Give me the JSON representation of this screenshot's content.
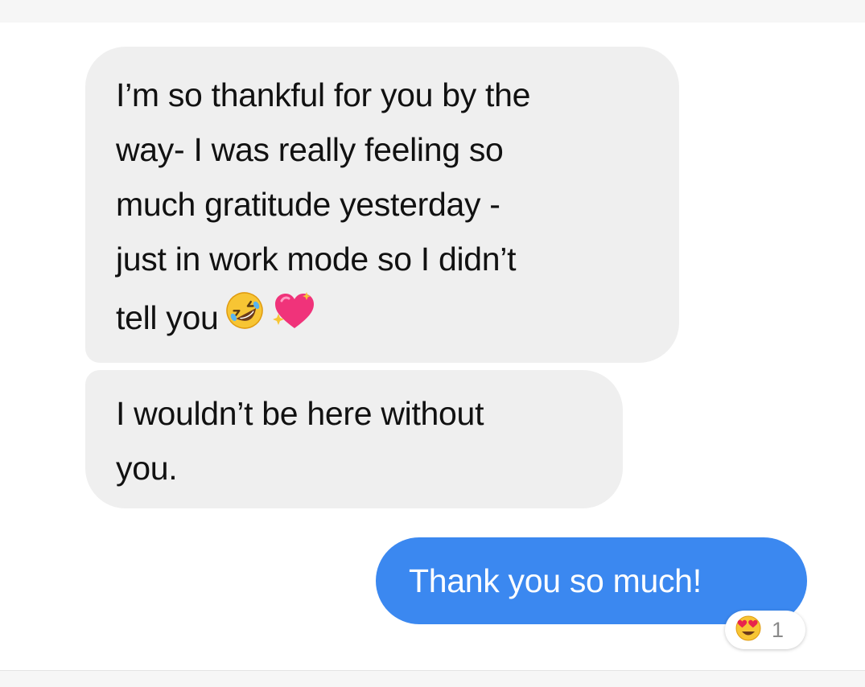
{
  "conversation": {
    "messages": [
      {
        "sender": "other",
        "lines": [
          "I’m so thankful for you by the",
          "way- I was really feeling so",
          "much gratitude yesterday -",
          "just in work mode so I didn’t",
          "tell you"
        ],
        "emojis": [
          "rolling-on-floor-laughing-emoji",
          "sparkling-heart-emoji"
        ]
      },
      {
        "sender": "other",
        "lines": [
          "I wouldn’t be here without",
          "you."
        ]
      },
      {
        "sender": "me",
        "text": "Thank you so much!",
        "reaction": {
          "emoji": "heart-eyes-emoji",
          "count": "1"
        }
      }
    ]
  },
  "colors": {
    "incoming_bubble": "#efefef",
    "outgoing_bubble": "#3b88f0",
    "incoming_text": "#111111",
    "outgoing_text": "#ffffff",
    "reaction_count": "#8a8a8a"
  }
}
